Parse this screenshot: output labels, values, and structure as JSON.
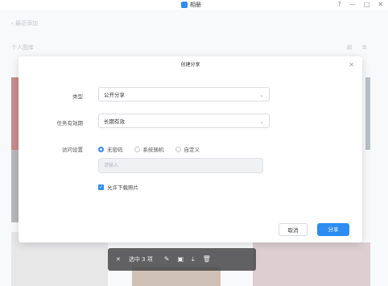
{
  "window": {
    "title": "相册"
  },
  "page": {
    "back_label": "最近添加",
    "section_label": "个人图库"
  },
  "dialog": {
    "title": "创建分享",
    "type_label": "类型",
    "type_value": "公开分享",
    "validity_label": "任务有效期",
    "validity_value": "长期有效",
    "access_label": "访问设置",
    "radio_options": [
      "无密码",
      "系统随机",
      "自定义"
    ],
    "password_placeholder": "请输入",
    "allow_download_label": "允许下载照片",
    "cancel_label": "取消",
    "share_label": "分享"
  },
  "toolbar": {
    "selection_text": "选中 3 项"
  },
  "colors": {
    "accent": "#2d8cf0"
  }
}
